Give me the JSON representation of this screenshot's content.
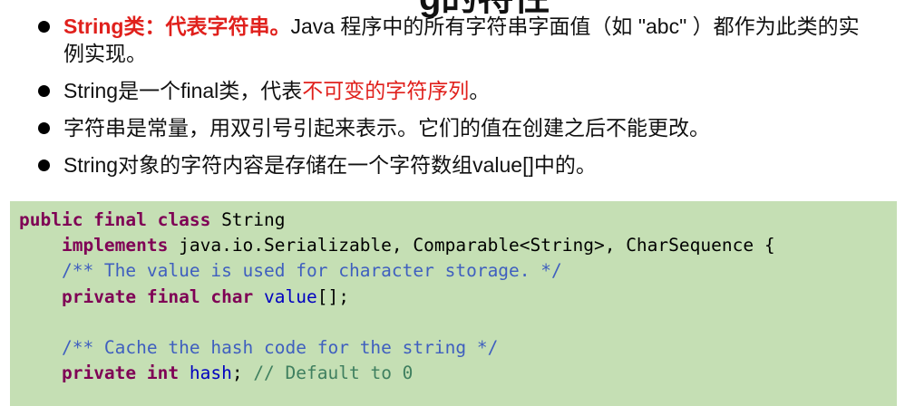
{
  "slide": {
    "title_fragment": "g的特性"
  },
  "bullets": [
    {
      "parts": [
        {
          "text": "String类：代表字符串。",
          "style": "red-bold"
        },
        {
          "text": "Java 程序中的所有字符串字面值（如 \"abc\" ）都作为此类的实例实现。",
          "style": "normal"
        }
      ]
    },
    {
      "parts": [
        {
          "text": "String是一个final类，代表",
          "style": "normal"
        },
        {
          "text": "不可变的字符序列",
          "style": "red"
        },
        {
          "text": "。",
          "style": "normal"
        }
      ]
    },
    {
      "parts": [
        {
          "text": "字符串是常量，用双引号引起来表示。它们的值在创建之后不能更改。",
          "style": "normal"
        }
      ]
    },
    {
      "parts": [
        {
          "text": "String对象的字符内容是存储在一个字符数组value[]中的。",
          "style": "normal"
        }
      ]
    }
  ],
  "code": {
    "background": "#c5dfb4",
    "lines": [
      [
        {
          "t": "public final class",
          "c": "kw"
        },
        {
          "t": " String",
          "c": "pl"
        }
      ],
      [
        {
          "t": "    ",
          "c": "pl"
        },
        {
          "t": "implements",
          "c": "kw"
        },
        {
          "t": " java.io.Serializable, Comparable<String>, CharSequence {",
          "c": "pl"
        }
      ],
      [
        {
          "t": "    ",
          "c": "pl"
        },
        {
          "t": "/** The value is used for character storage. */",
          "c": "cm"
        }
      ],
      [
        {
          "t": "    ",
          "c": "pl"
        },
        {
          "t": "private final char",
          "c": "kw"
        },
        {
          "t": " ",
          "c": "pl"
        },
        {
          "t": "value",
          "c": "fld"
        },
        {
          "t": "[];",
          "c": "pl"
        }
      ],
      [],
      [
        {
          "t": "    ",
          "c": "pl"
        },
        {
          "t": "/** Cache the hash code for the string */",
          "c": "cm"
        }
      ],
      [
        {
          "t": "    ",
          "c": "pl"
        },
        {
          "t": "private int",
          "c": "kw"
        },
        {
          "t": " ",
          "c": "pl"
        },
        {
          "t": "hash",
          "c": "fld"
        },
        {
          "t": "; ",
          "c": "pl"
        },
        {
          "t": "// Default to 0",
          "c": "lc"
        }
      ]
    ]
  }
}
